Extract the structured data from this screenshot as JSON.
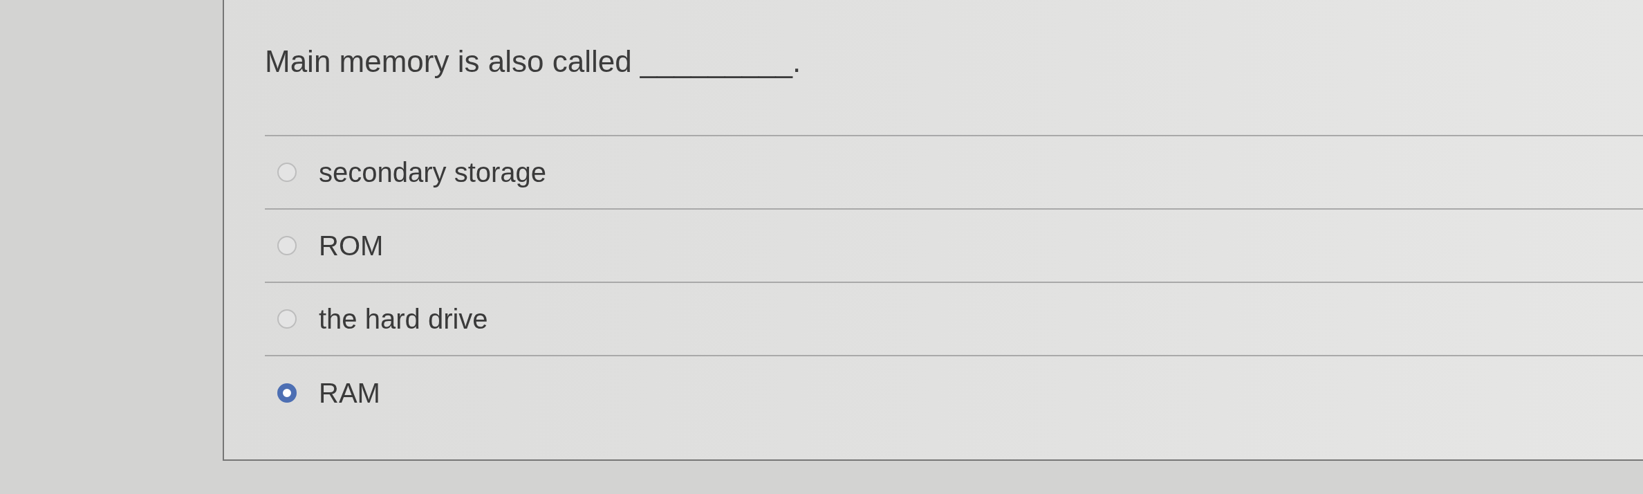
{
  "question": {
    "text": "Main memory is also called _________."
  },
  "options": [
    {
      "label": "secondary storage",
      "selected": false
    },
    {
      "label": "ROM",
      "selected": false
    },
    {
      "label": "the hard drive",
      "selected": false
    },
    {
      "label": "RAM",
      "selected": true
    }
  ]
}
